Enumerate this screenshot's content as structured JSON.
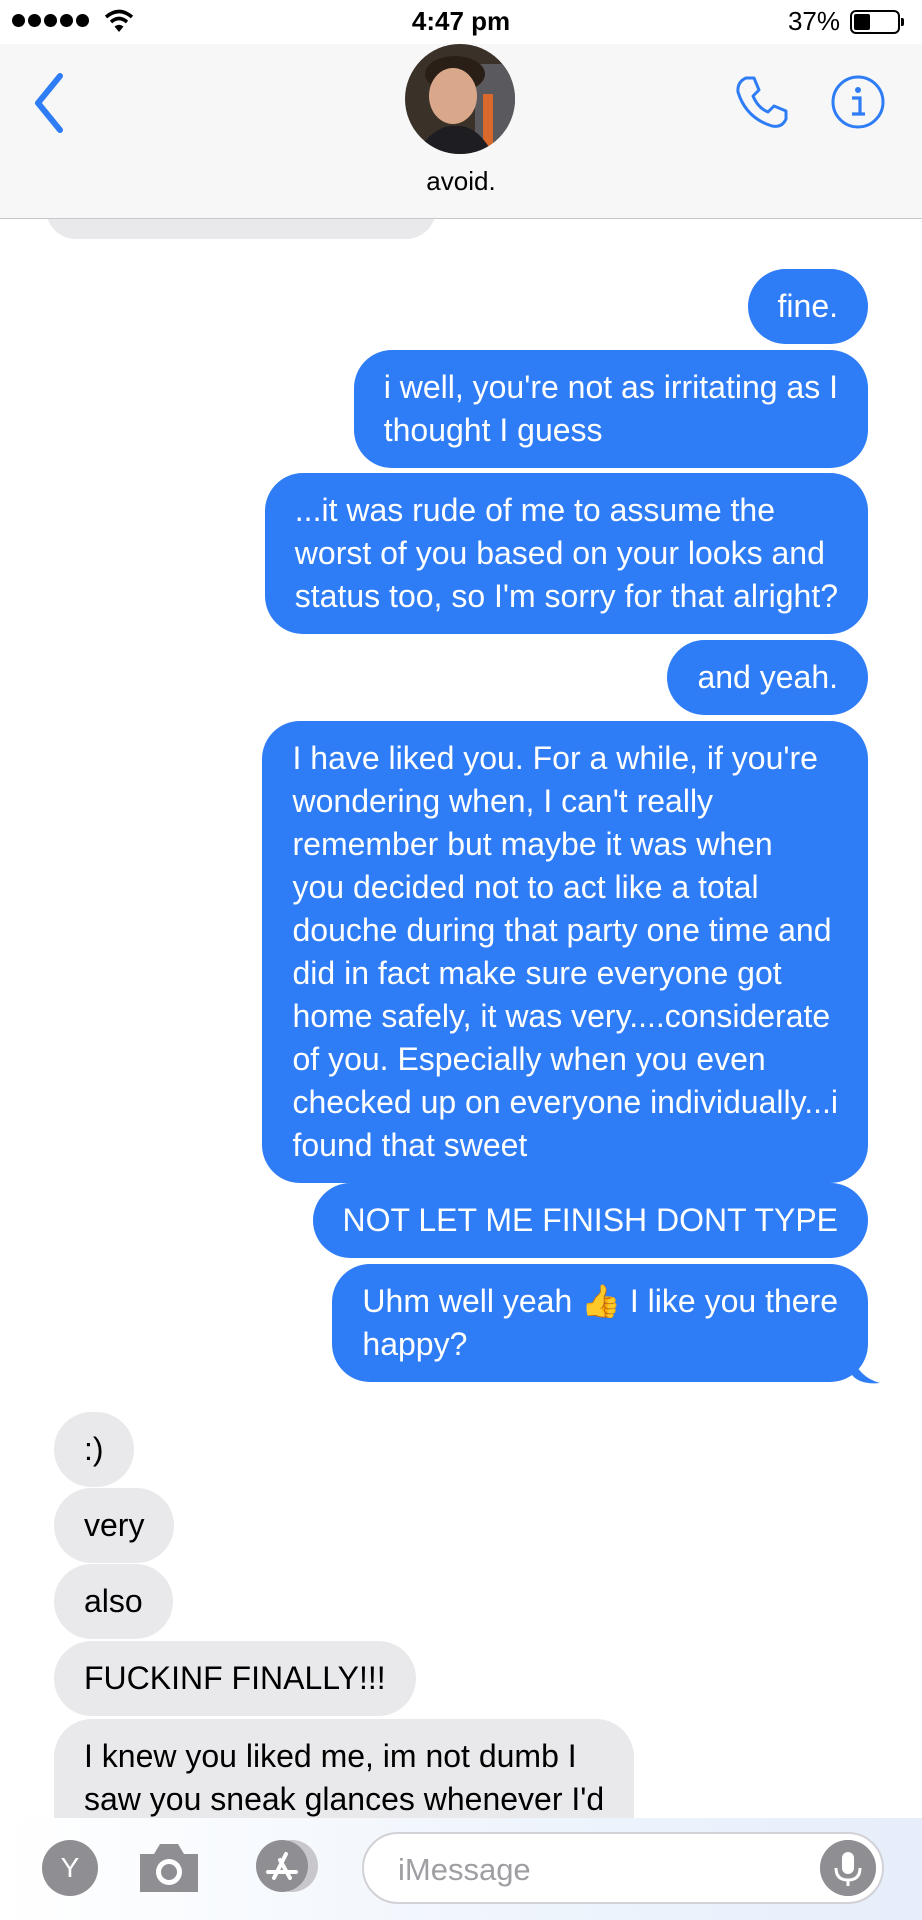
{
  "status_bar": {
    "time": "4:47 pm",
    "battery_percent": "37%",
    "battery_level": 0.37,
    "signal_bars": 5
  },
  "header": {
    "contact_name": "avoid.",
    "back_icon": "chevron-left-icon",
    "call_icon": "phone-icon",
    "info_icon": "info-icon"
  },
  "messages": [
    {
      "from": "me",
      "text": "fine."
    },
    {
      "from": "me",
      "text": "i well, you're not as irritating as I\nthought I guess"
    },
    {
      "from": "me",
      "text": "...it was rude of me to assume the\nworst of you based on your looks and\nstatus too, so I'm sorry for that alright?"
    },
    {
      "from": "me",
      "text": "and yeah."
    },
    {
      "from": "me",
      "text": "I have liked you. For a while, if you're\nwondering when, I can't really\nremember but maybe it was when\nyou decided not to act like a total\ndouche during that party one time and\ndid in fact make sure everyone got\nhome safely, it was very....considerate\nof you. Especially when you even\nchecked up on everyone individually...i\nfound that sweet"
    },
    {
      "from": "me",
      "text": "NOT LET ME FINISH DONT TYPE"
    },
    {
      "from": "me",
      "text": "Uhm well yeah 👍 I like you there\nhappy?"
    },
    {
      "from": "them",
      "text": ":)"
    },
    {
      "from": "them",
      "text": "very"
    },
    {
      "from": "them",
      "text": "also"
    },
    {
      "from": "them",
      "text": "FUCKINF FINALLY!!!"
    },
    {
      "from": "them",
      "text": "I knew you liked me, im not dumb I\nsaw you sneak glances whenever I'd"
    }
  ],
  "input_bar": {
    "app_label": "Y",
    "placeholder": "iMessage",
    "camera_icon": "camera-icon",
    "appstore_icon": "app-store-icon",
    "mic_icon": "microphone-icon"
  },
  "colors": {
    "outgoing_bubble": "#2f7df6",
    "incoming_bubble": "#e9e9eb",
    "accent": "#2f7df6"
  }
}
